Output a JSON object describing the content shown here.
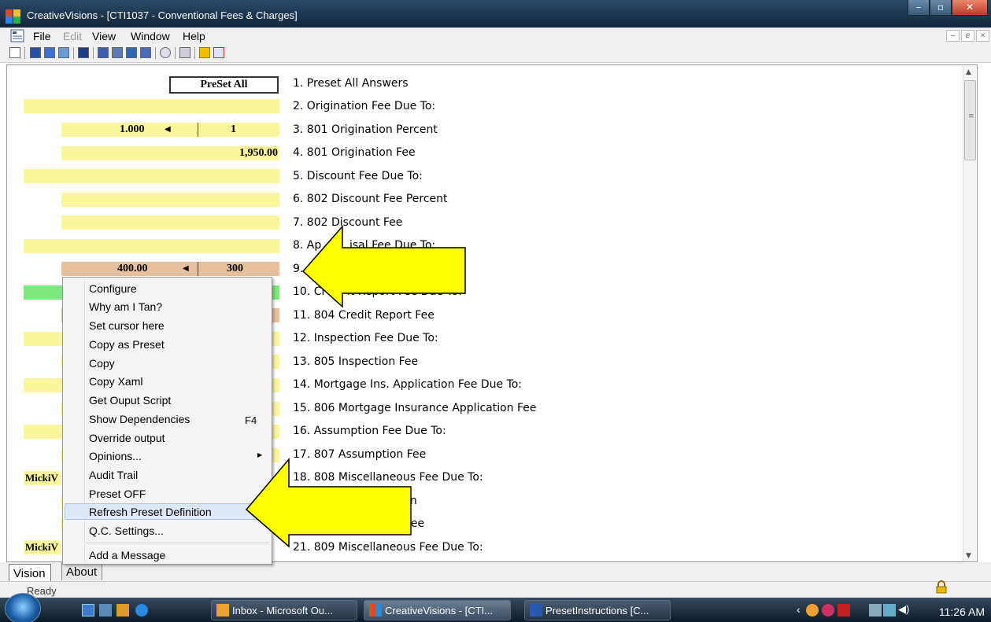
{
  "window": {
    "title": "CreativeVisions - [CTI1037 - Conventional Fees & Charges]",
    "controls": {
      "minimize": "–",
      "maximize": "▫",
      "close": "✕"
    }
  },
  "menubar": {
    "items": [
      "File",
      "Edit",
      "View",
      "Window",
      "Help"
    ],
    "mdi_controls": {
      "minimize": "–",
      "restore": "ⅇ",
      "close": "×"
    }
  },
  "form": {
    "preset_button": "PreSet All",
    "values": {
      "q3_left": "1.000",
      "q3_right": "1",
      "q4": "1,950.00",
      "q9_left": "400.00",
      "q9_right": "300"
    },
    "micki_1": "MickiV",
    "micki_2": "MickiV"
  },
  "questions": [
    "1. Preset All Answers",
    "2. Origination Fee Due To:",
    "3. 801 Origination Percent",
    "4. 801 Origination Fee",
    "5. Discount Fee Due To:",
    "6. 802 Discount Fee Percent",
    "7. 802 Discount Fee",
    "8. Ap",
    "9.",
    "10. Cr",
    "11. 804 Credit Report Fee",
    "12. Inspection Fee Due To:",
    "13. 805 Inspection Fee",
    "14. Mortgage Ins. Application Fee Due To:",
    "15. 806 Mortgage Insurance Application Fee",
    "16. Assumption Fee Due To:",
    "17. 807 Assumption Fee",
    "18. 808 Miscellaneous Fee Due To:",
    "21. 809 Miscellaneous Fee Due To:"
  ],
  "question_fragments": {
    "q8_tail": "isal Fee Due To:",
    "q10_tail": "it Report Fee Due To:",
    "q19_tail": "ption",
    "q20_tail": "us Fee"
  },
  "context_menu": {
    "items": [
      "Configure",
      "Why am I Tan?",
      "Set cursor here",
      "Copy as Preset",
      "Copy",
      "Copy Xaml",
      "Get Ouput Script",
      "Show Dependencies",
      "Override output",
      "Opinions...",
      "Audit Trail",
      "Preset OFF",
      "Refresh Preset Definition",
      "Q.C. Settings...",
      "Add a Message"
    ],
    "shortcut_show_dependencies": "F4",
    "highlighted_item": "Refresh Preset Definition"
  },
  "tabs": [
    "Vision",
    "About"
  ],
  "status": {
    "text": "Ready"
  },
  "taskbar": {
    "items": [
      "Inbox - Microsoft Ou...",
      "CreativeVisions - [CTI...",
      "PresetInstructions [C..."
    ],
    "clock": "11:26 AM"
  },
  "colors": {
    "field_yellow": "#fbf59c",
    "field_tan": "#e6bf9c",
    "field_green": "#7de87d",
    "arrow_yellow": "#ffff00"
  },
  "icons": [
    "app-icon",
    "document-icon",
    "scroll-up-icon",
    "scroll-down-icon",
    "submenu-arrow-icon",
    "lock-icon",
    "start-orb-icon",
    "outlook-icon",
    "creativevisions-icon",
    "word-icon",
    "speaker-icon",
    "network-icon"
  ]
}
